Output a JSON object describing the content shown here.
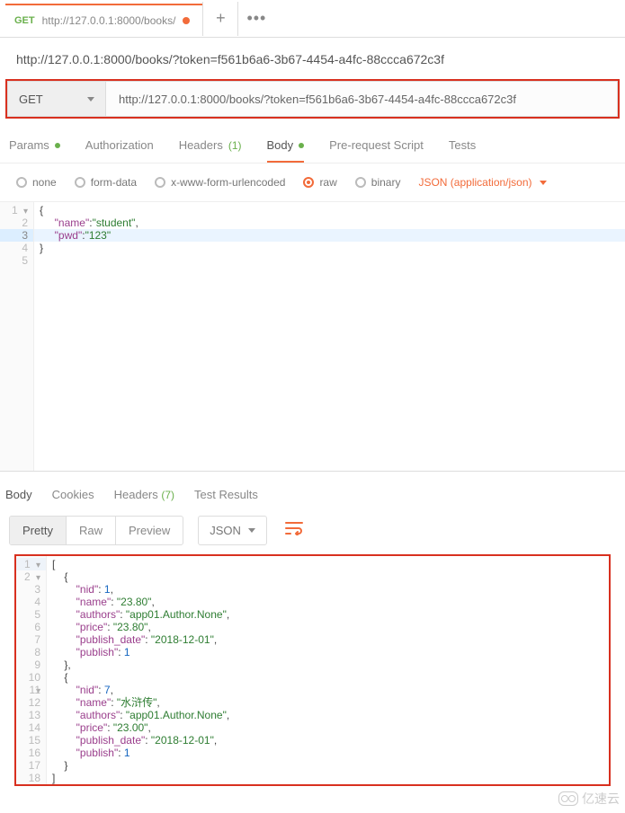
{
  "tab": {
    "method": "GET",
    "url_short": "http://127.0.0.1:8000/books/"
  },
  "request_name": "http://127.0.0.1:8000/books/?token=f561b6a6-3b67-4454-a4fc-88ccca672c3f",
  "method": "GET",
  "url": "http://127.0.0.1:8000/books/?token=f561b6a6-3b67-4454-a4fc-88ccca672c3f",
  "req_tabs": {
    "params": "Params",
    "authorization": "Authorization",
    "headers": "Headers",
    "headers_count": "(1)",
    "body": "Body",
    "prereq": "Pre-request Script",
    "tests": "Tests"
  },
  "body_types": {
    "none": "none",
    "form": "form-data",
    "xform": "x-www-form-urlencoded",
    "raw": "raw",
    "binary": "binary",
    "content_type": "JSON (application/json)"
  },
  "body_code": {
    "l1": "{",
    "l2_key": "\"name\"",
    "l2_v": "\"student\"",
    "l3_key": "\"pwd\"",
    "l3_v": "\"123\"",
    "l4": "}"
  },
  "resp_tabs": {
    "body": "Body",
    "cookies": "Cookies",
    "headers": "Headers",
    "headers_count": "(7)",
    "tests": "Test Results"
  },
  "resp_tool": {
    "pretty": "Pretty",
    "raw": "Raw",
    "preview": "Preview",
    "format": "JSON"
  },
  "response": [
    {
      "nid": 1,
      "name": "23.80",
      "authors": "app01.Author.None",
      "price": "23.80",
      "publish_date": "2018-12-01",
      "publish": 1
    },
    {
      "nid": 7,
      "name": "水浒传",
      "authors": "app01.Author.None",
      "price": "23.00",
      "publish_date": "2018-12-01",
      "publish": 1
    }
  ],
  "resp_lines": {
    "l1": "[",
    "l2": "    {",
    "l3k": "\"nid\"",
    "l3v": "1",
    "l4k": "\"name\"",
    "l4v": "\"23.80\"",
    "l5k": "\"authors\"",
    "l5v": "\"app01.Author.None\"",
    "l6k": "\"price\"",
    "l6v": "\"23.80\"",
    "l7k": "\"publish_date\"",
    "l7v": "\"2018-12-01\"",
    "l8k": "\"publish\"",
    "l8v": "1",
    "l9": "    },",
    "l10": "    {",
    "l11k": "\"nid\"",
    "l11v": "7",
    "l12k": "\"name\"",
    "l12v": "\"水浒传\"",
    "l13k": "\"authors\"",
    "l13v": "\"app01.Author.None\"",
    "l14k": "\"price\"",
    "l14v": "\"23.00\"",
    "l15k": "\"publish_date\"",
    "l15v": "\"2018-12-01\"",
    "l16k": "\"publish\"",
    "l16v": "1",
    "l17": "    }",
    "l18": "]"
  },
  "watermark": "亿速云"
}
